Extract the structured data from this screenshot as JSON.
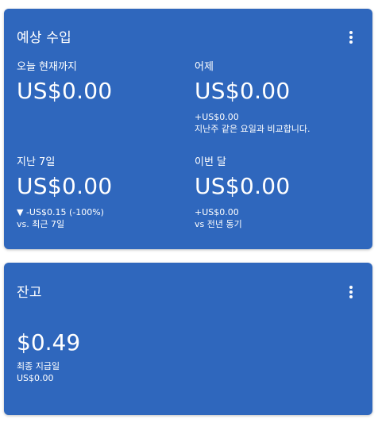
{
  "earnings_card": {
    "title": "예상 수입",
    "metrics": [
      {
        "label": "오늘 현재까지",
        "value": "US$0.00",
        "sub1": "",
        "sub2": ""
      },
      {
        "label": "어제",
        "value": "US$0.00",
        "sub1": "+US$0.00",
        "sub2": "지난주 같은 요일과 비교합니다."
      },
      {
        "label": "지난 7일",
        "value": "US$0.00",
        "sub1": "▼ -US$0.15 (-100%)",
        "sub2": "vs. 최근 7일"
      },
      {
        "label": "이번 달",
        "value": "US$0.00",
        "sub1": "+US$0.00",
        "sub2": "vs 전년 동기"
      }
    ]
  },
  "balance_card": {
    "title": "잔고",
    "amount": "$0.49",
    "last_payment_label": "최종 지급일",
    "last_payment_value": "US$0.00"
  },
  "colors": {
    "card_background": "#2f67bd",
    "text": "#ffffff"
  },
  "icons": {
    "more": "more-vert-icon"
  }
}
